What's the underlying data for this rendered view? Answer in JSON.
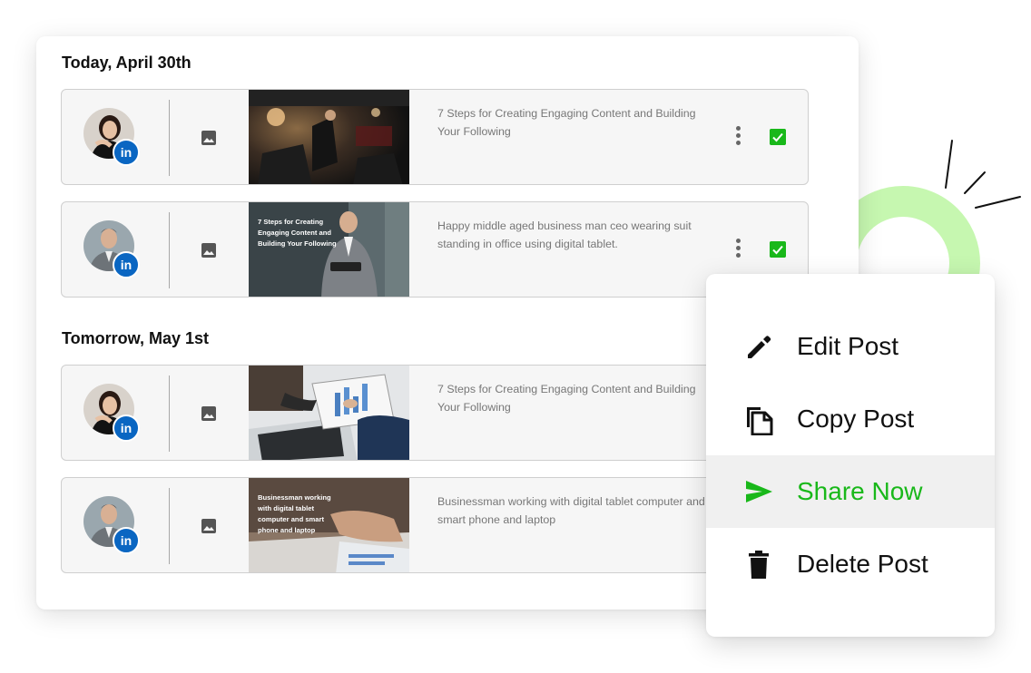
{
  "schedule": {
    "groups": [
      {
        "heading": "Today, April 30th",
        "posts": [
          {
            "network": "in",
            "media_icon": "image-icon",
            "thumb_caption": "",
            "text": "7 Steps for Creating Engaging Content and Building Your Following",
            "approved": true
          },
          {
            "network": "in",
            "media_icon": "image-icon",
            "thumb_caption": "7 Steps for Creating Engaging Content and Building Your Following",
            "text": "Happy middle aged business man ceo wearing suit standing in office using digital tablet.",
            "approved": true
          }
        ]
      },
      {
        "heading": "Tomorrow, May 1st",
        "posts": [
          {
            "network": "in",
            "media_icon": "image-icon",
            "thumb_caption": "",
            "text": "7 Steps for Creating Engaging Content and Building Your Following",
            "approved": false
          },
          {
            "network": "in",
            "media_icon": "image-icon",
            "thumb_caption": "Businessman working with digital tablet computer and smart phone and laptop",
            "text": "Businessman working with digital tablet computer and smart phone and laptop",
            "approved": false
          }
        ]
      }
    ]
  },
  "context_menu": {
    "items": [
      {
        "label": "Edit Post",
        "icon": "pencil-icon"
      },
      {
        "label": "Copy Post",
        "icon": "copy-icon"
      },
      {
        "label": "Share Now",
        "icon": "send-icon",
        "highlighted": true
      },
      {
        "label": "Delete Post",
        "icon": "trash-icon"
      }
    ]
  },
  "colors": {
    "accent_green": "#19b81a",
    "linkedin_blue": "#0a66c2",
    "decor_ring": "#c6f7b0",
    "row_background": "#f6f6f6"
  }
}
